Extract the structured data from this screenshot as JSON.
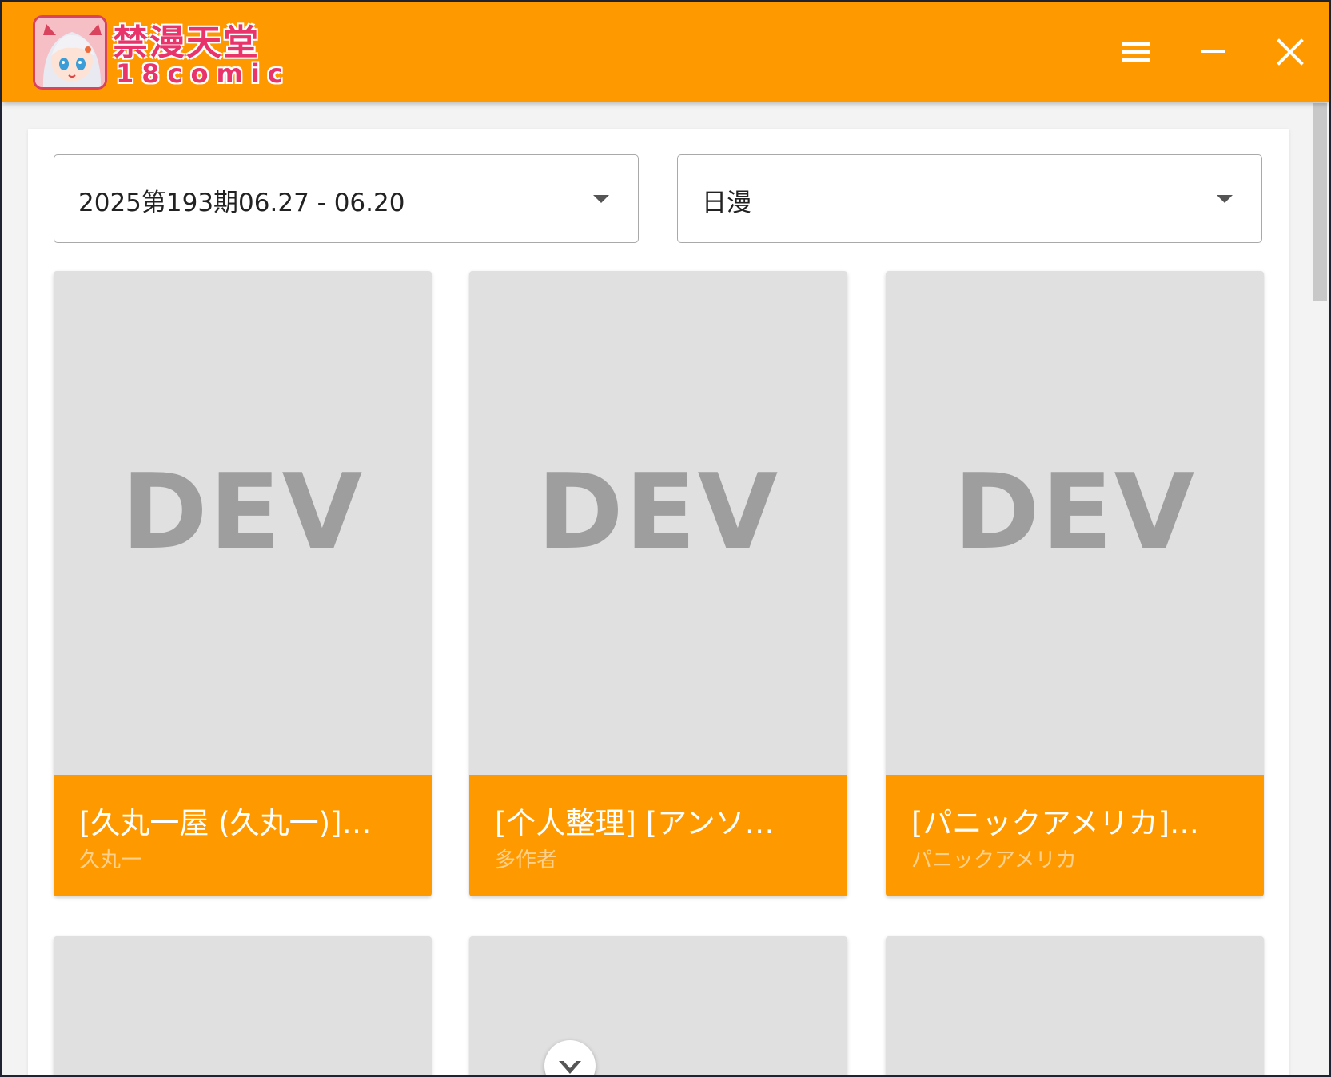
{
  "app": {
    "logo_cn": "禁漫天堂",
    "logo_en": "18comic",
    "accent_color": "#ff9900"
  },
  "titlebar": {
    "menu_icon": "hamburger-menu-icon",
    "minimize_icon": "minimize-icon",
    "close_icon": "close-icon"
  },
  "filters": {
    "period": {
      "value": "2025第193期06.27 - 06.20"
    },
    "category": {
      "value": "日漫"
    }
  },
  "cards": [
    {
      "cover_text": "DEV",
      "title": "[久丸一屋 (久丸一)]…",
      "author": "久丸一"
    },
    {
      "cover_text": "DEV",
      "title": "[个人整理] [アンソ…",
      "author": "多作者"
    },
    {
      "cover_text": "DEV",
      "title": "[パニックアメリカ]…",
      "author": "パニックアメリカ"
    }
  ],
  "scroll_down_icon": "chevron-down-icon"
}
